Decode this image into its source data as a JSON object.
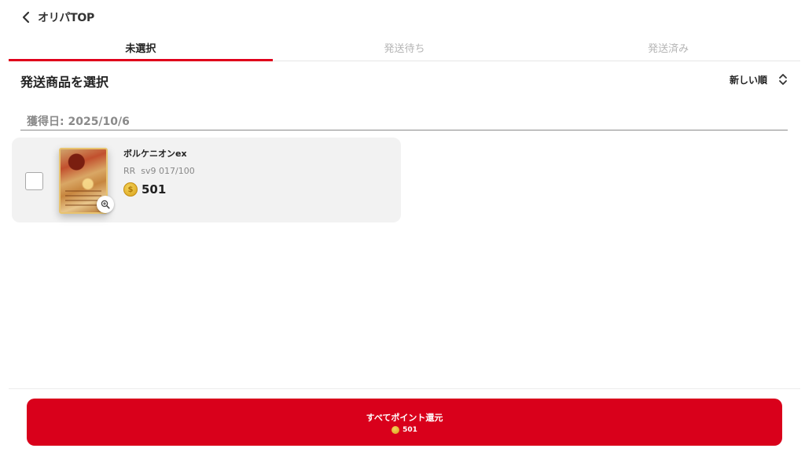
{
  "header": {
    "back_label": "オリパTOP"
  },
  "tabs": [
    {
      "label": "未選択",
      "active": true
    },
    {
      "label": "発送待ち",
      "active": false
    },
    {
      "label": "発送済み",
      "active": false
    }
  ],
  "section": {
    "title": "発送商品を選択",
    "sort_label": "新しい順"
  },
  "group": {
    "date_label": "獲得日: 2025/10/6"
  },
  "items": [
    {
      "name": "ボルケニオンex",
      "rarity": "RR",
      "code": "sv9 017/100",
      "points": "501",
      "checked": false,
      "icons": {
        "zoom": "zoom-in-icon",
        "coin": "coin-icon"
      }
    }
  ],
  "footer": {
    "button_label": "すべてポイント還元",
    "total_points": "501"
  },
  "colors": {
    "accent": "#d9001b",
    "tab_indicator": "#e0001b",
    "card_bg": "#f2f2f2",
    "coin": "#e0b42a"
  }
}
